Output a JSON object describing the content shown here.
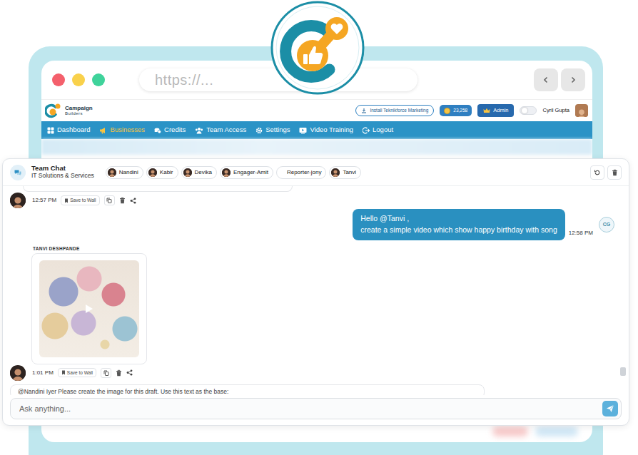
{
  "browser": {
    "window_buttons": [
      {
        "color": "#f4606c"
      },
      {
        "color": "#f9d14b"
      },
      {
        "color": "#3fd39b"
      }
    ],
    "url": "https://..."
  },
  "app": {
    "logo": {
      "line1": "Campaign",
      "line2": "Builders"
    },
    "install_label": "Install Teknikforce Marketing",
    "credits": "23,258",
    "role": "Admin",
    "dark_mode": {
      "on": false
    },
    "user_name": "Cyril Gupta",
    "nav": [
      {
        "label": "Dashboard",
        "selected": false
      },
      {
        "label": "Businesses",
        "selected": true
      },
      {
        "label": "Credits",
        "selected": false
      },
      {
        "label": "Team Access",
        "selected": false
      },
      {
        "label": "Settings",
        "selected": false
      },
      {
        "label": "Video Training",
        "selected": false
      },
      {
        "label": "Logout",
        "selected": false
      }
    ]
  },
  "chat": {
    "title": "Team Chat",
    "subtitle": "IT Solutions & Services",
    "members": [
      {
        "name": "Nandini",
        "avatar": true
      },
      {
        "name": "Kabir",
        "avatar": true
      },
      {
        "name": "Devika",
        "avatar": true
      },
      {
        "name": "Engager-Amit",
        "avatar": true
      },
      {
        "name": "Reporter-jony",
        "avatar": false
      },
      {
        "name": "Tanvi",
        "avatar": true
      }
    ],
    "messages": [
      {
        "kind": "cut",
        "time": "12:57 PM",
        "save_label": "Save to Wall"
      },
      {
        "kind": "user",
        "lines": [
          "Hello @Tanvi ,",
          "create a simple video which show happy birthday with song"
        ],
        "time": "12:58 PM",
        "initials": "CG"
      },
      {
        "kind": "video",
        "sender": "TANVI DESHPANDE",
        "time": "1:01 PM",
        "save_label": "Save to Wall"
      },
      {
        "kind": "draft",
        "text": "@Nandini Iyer Please create the image for this draft. Use this text as the base:"
      }
    ],
    "input": {
      "placeholder": "Ask anything..."
    }
  }
}
